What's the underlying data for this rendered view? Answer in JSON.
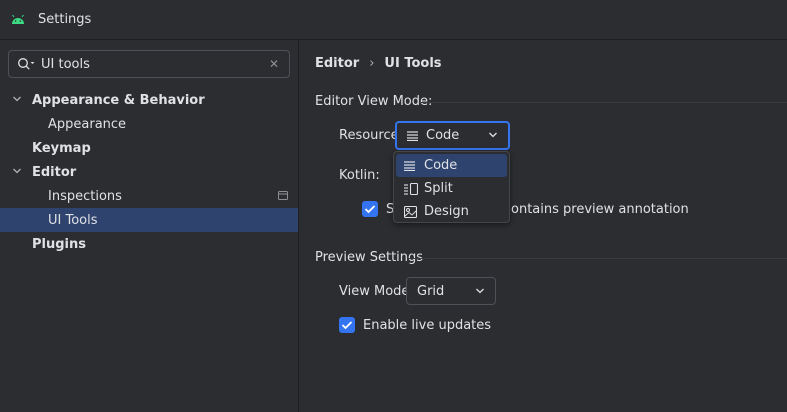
{
  "window": {
    "title": "Settings"
  },
  "search": {
    "value": "UI tools"
  },
  "tree": {
    "appearance_behavior": "Appearance & Behavior",
    "appearance": "Appearance",
    "keymap": "Keymap",
    "editor": "Editor",
    "inspections": "Inspections",
    "ui_tools": "UI Tools",
    "plugins": "Plugins"
  },
  "breadcrumb": {
    "parent": "Editor",
    "sep": "›",
    "current": "UI Tools"
  },
  "editor_view_mode": {
    "title": "Editor View Mode:",
    "resource_label": "Resource:",
    "resource_value": "Code",
    "kotlin_label": "Kotlin:",
    "checkbox_prefix": "S",
    "checkbox_suffix": "ontains preview annotation",
    "checkbox_checked": true
  },
  "resource_dropdown": {
    "options": [
      {
        "label": "Code",
        "icon": "lines-icon",
        "selected": true
      },
      {
        "label": "Split",
        "icon": "split-icon",
        "selected": false
      },
      {
        "label": "Design",
        "icon": "design-icon",
        "selected": false
      }
    ]
  },
  "preview_settings": {
    "title": "Preview Settings",
    "view_mode_label": "View Mode:",
    "view_mode_value": "Grid",
    "live_updates_label": "Enable live updates",
    "live_updates_checked": true
  },
  "colors": {
    "background": "#2b2d30",
    "selection": "#2e436e",
    "accent": "#3574f0",
    "android_green": "#3ddc84"
  }
}
